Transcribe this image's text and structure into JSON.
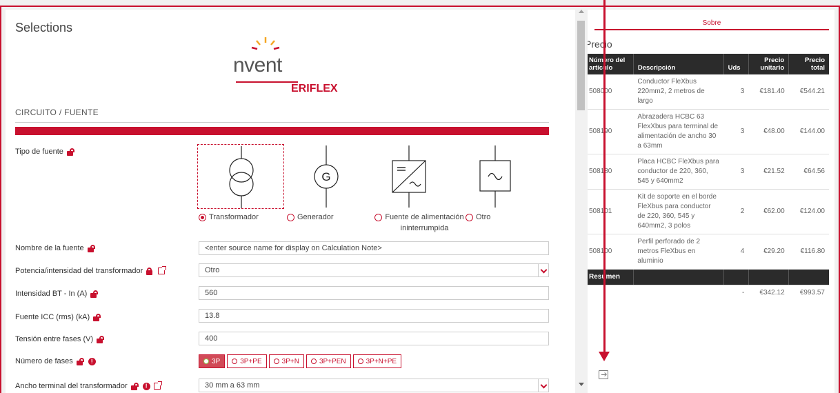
{
  "panel": {
    "title": "Selections"
  },
  "logo": {
    "brand": "nVent",
    "sub": "ERIFLEX"
  },
  "section": {
    "title": "CIRCUITO / FUENTE"
  },
  "source_type": {
    "label": "Tipo de fuente",
    "options": [
      {
        "label": "Transformador",
        "selected": true,
        "icon": "transformer-symbol"
      },
      {
        "label": "Generador",
        "selected": false,
        "icon": "generator-symbol"
      },
      {
        "label": "Fuente de alimentación ininterrumpida",
        "selected": false,
        "icon": "ups-symbol"
      },
      {
        "label": "Otro",
        "selected": false,
        "icon": "ac-source-symbol"
      }
    ]
  },
  "fields": {
    "source_name": {
      "label": "Nombre de la fuente",
      "value": "<enter source name for display on Calculation Note>"
    },
    "transformer_power": {
      "label": "Potencia/intensidad del transformador",
      "value": "Otro"
    },
    "low_voltage_current": {
      "label": "Intensidad BT - In (A)",
      "value": "560"
    },
    "icc": {
      "label": "Fuente ICC (rms) (kA)",
      "value": "13.8"
    },
    "voltage": {
      "label": "Tensión entre fases (V)",
      "value": "400"
    },
    "phases": {
      "label": "Número de fases",
      "options": [
        "3P",
        "3P+PE",
        "3P+N",
        "3P+PEN",
        "3P+N+PE"
      ],
      "selected": "3P"
    },
    "terminal_width": {
      "label": "Ancho terminal del transformador",
      "value": "30 mm a 63 mm"
    }
  },
  "sidebar": {
    "tab": "Sobre",
    "title": "Precio",
    "columns": [
      "Número del artículo",
      "Descripción",
      "Uds",
      "Precio unitario",
      "Precio total"
    ],
    "rows": [
      {
        "sku": "508000",
        "desc": "Conductor FleXbus 220mm2, 2 metros de largo",
        "qty": "3",
        "unit": "€181.40",
        "total": "€544.21"
      },
      {
        "sku": "508190",
        "desc": "Abrazadera HCBC 63 FlexXbus para terminal de alimentación de ancho 30 a 63mm",
        "qty": "3",
        "unit": "€48.00",
        "total": "€144.00"
      },
      {
        "sku": "508180",
        "desc": "Placa HCBC FleXbus para conductor de 220, 360, 545 y 640mm2",
        "qty": "3",
        "unit": "€21.52",
        "total": "€64.56"
      },
      {
        "sku": "508101",
        "desc": "Kit de soporte en el borde FleXbus para conductor de 220, 360, 545 y 640mm2, 3 polos",
        "qty": "2",
        "unit": "€62.00",
        "total": "€124.00"
      },
      {
        "sku": "508100",
        "desc": "Perfil perforado de 2 metros FleXbus en aluminio",
        "qty": "4",
        "unit": "€29.20",
        "total": "€116.80"
      }
    ],
    "summary_label": "Resumen",
    "summary": {
      "qty": "-",
      "unit": "€342.12",
      "total": "€993.57"
    }
  },
  "colors": {
    "accent": "#c8102e",
    "header_dark": "#2b2b2b"
  }
}
